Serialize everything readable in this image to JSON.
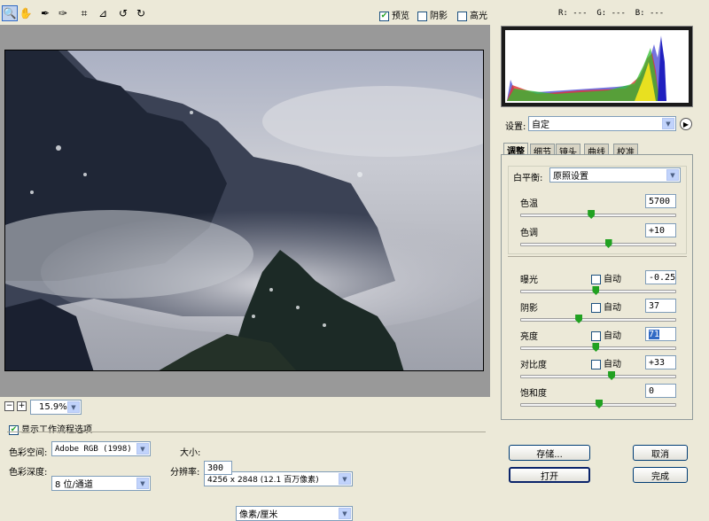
{
  "toolbar": {
    "tools": [
      "zoom-icon",
      "hand-icon",
      "white-balance-icon",
      "color-sampler-icon",
      "crop-icon",
      "straighten-icon",
      "rotate-left-icon",
      "rotate-right-icon"
    ],
    "preview": {
      "label": "预览",
      "checked": true
    },
    "shadows": {
      "label": "阴影",
      "checked": false
    },
    "highlights": {
      "label": "高光",
      "checked": false
    }
  },
  "rgb": {
    "r": "R: ---",
    "g": "G: ---",
    "b": "B: ---"
  },
  "zoom": {
    "value": "15.9%",
    "minus": "−",
    "plus": "+"
  },
  "settings": {
    "label": "设置:",
    "value": "自定"
  },
  "tabs": [
    "调整",
    "细节",
    "镜头",
    "曲线",
    "校准"
  ],
  "white_balance": {
    "label": "白平衡:",
    "value": "原照设置"
  },
  "adjust": [
    {
      "label": "色温",
      "value": "5700",
      "thumb": 0.45
    },
    {
      "label": "色调",
      "value": "+10",
      "thumb": 0.56
    }
  ],
  "tone": [
    {
      "label": "曝光",
      "auto": "自动",
      "value": "-0.25",
      "thumb": 0.48
    },
    {
      "label": "阴影",
      "auto": "自动",
      "value": "37",
      "thumb": 0.37
    },
    {
      "label": "亮度",
      "auto": "自动",
      "value": "71",
      "thumb": 0.48
    },
    {
      "label": "对比度",
      "auto": "自动",
      "value": "+33",
      "thumb": 0.58
    },
    {
      "label": "饱和度",
      "value": "0",
      "thumb": 0.5
    }
  ],
  "workflow": {
    "toggle": "显示工作流程选项",
    "space_label": "色彩空间:",
    "space_value": "Adobe RGB (1998)",
    "depth_label": "色彩深度:",
    "depth_value": "8 位/通道",
    "size_label": "大小:",
    "size_value": "4256 x 2848  (12.1 百万像素)",
    "res_label": "分辨率:",
    "res_value": "300",
    "res_unit": "像素/厘米"
  },
  "buttons": {
    "save": "存储...",
    "cancel": "取消",
    "open": "打开",
    "done": "完成"
  }
}
